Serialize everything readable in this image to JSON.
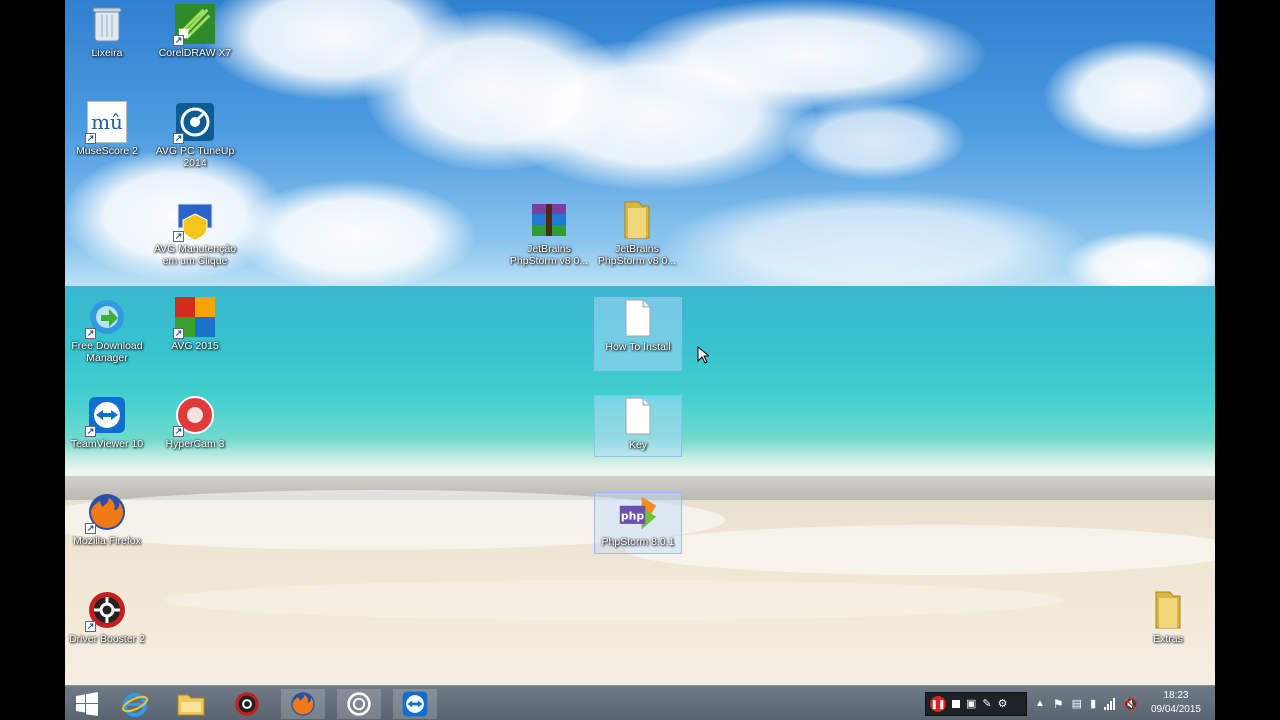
{
  "desktop": {
    "icons": [
      {
        "label": "Lixeira",
        "icon": "recycle-bin-icon"
      },
      {
        "label": "CorelDRAW X7",
        "icon": "coreldraw-icon"
      },
      {
        "label": "MuseScore 2",
        "icon": "musescore-icon"
      },
      {
        "label": "AVG PC TuneUp 2014",
        "icon": "avg-tuneup-icon"
      },
      {
        "label": "AVG Manutenção em um Clique",
        "icon": "avg-maintenance-icon"
      },
      {
        "label": "JetBrains PhpStorm v8 0...",
        "icon": "winrar-archive-icon"
      },
      {
        "label": "JetBrains PhpStorm v8 0...",
        "icon": "folder-icon"
      },
      {
        "label": "Free Download Manager",
        "icon": "free-download-manager-icon"
      },
      {
        "label": "AVG 2015",
        "icon": "avg-icon"
      },
      {
        "label": "How To Install",
        "icon": "text-file-icon"
      },
      {
        "label": "TeamViewer 10",
        "icon": "teamviewer-icon"
      },
      {
        "label": "HyperCam 3",
        "icon": "hypercam-icon"
      },
      {
        "label": "Key",
        "icon": "text-file-icon"
      },
      {
        "label": "Mozilla Firefox",
        "icon": "firefox-icon"
      },
      {
        "label": "PhpStorm 8.0.1",
        "icon": "phpstorm-icon"
      },
      {
        "label": "Driver Booster 2",
        "icon": "driver-booster-icon"
      },
      {
        "label": "Extras",
        "icon": "folder-icon"
      }
    ]
  },
  "taskbar": {
    "buttons": [
      {
        "name": "start-icon"
      },
      {
        "name": "internet-explorer-icon"
      },
      {
        "name": "file-explorer-icon"
      },
      {
        "name": "driver-booster-icon"
      },
      {
        "name": "firefox-icon"
      },
      {
        "name": "avg-tuneup-icon"
      },
      {
        "name": "teamviewer-icon"
      }
    ],
    "clock": {
      "time": "18:23",
      "date": "09/04/2015"
    }
  }
}
